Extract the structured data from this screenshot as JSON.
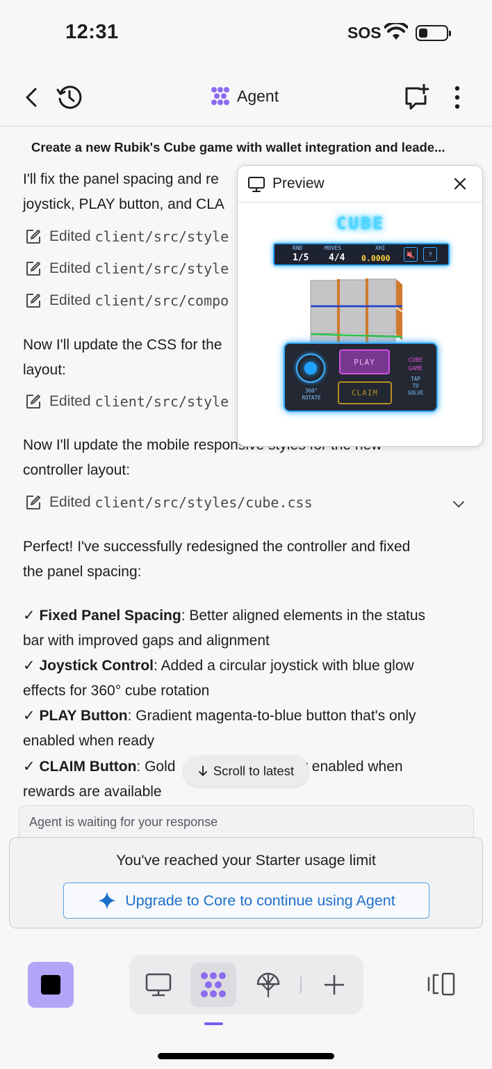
{
  "status_bar": {
    "time": "12:31",
    "sos": "SOS"
  },
  "header": {
    "title": "Agent",
    "icons": [
      "back-icon",
      "history-icon",
      "agent-logo-icon",
      "new-chat-icon",
      "more-icon"
    ]
  },
  "topic": "Create a new Rubik's Cube game with wallet integration and leade...",
  "messages": {
    "m1_line1": "I'll fix the panel spacing and re",
    "m1_line2": "joystick, PLAY button, and CLA",
    "edits1": [
      {
        "label": "Edited",
        "path": "client/src/style"
      },
      {
        "label": "Edited",
        "path": "client/src/style"
      },
      {
        "label": "Edited",
        "path": "client/src/compo"
      }
    ],
    "m2_line1": "Now I'll update the CSS for the",
    "m2_line2": "layout:",
    "edits2": [
      {
        "label": "Edited",
        "path": "client/src/style"
      }
    ],
    "m3_line1": "Now I'll update the mobile responsive styles for the new",
    "m3_line2": "controller layout:",
    "edits3": [
      {
        "label": "Edited",
        "path": "client/src/styles/cube.css"
      }
    ],
    "m4_line1": "Perfect! I've successfully redesigned the controller and fixed",
    "m4_line2": "the panel spacing:",
    "bullets": [
      {
        "check": "✓",
        "bold": "Fixed Panel Spacing",
        "l1": ": Better aligned elements in the status",
        "l2": "bar with improved gaps and alignment"
      },
      {
        "check": "✓",
        "bold": "Joystick Control",
        "l1": ": Added a circular joystick with blue glow",
        "l2": "effects for 360° cube rotation"
      },
      {
        "check": "✓",
        "bold": "PLAY Button",
        "l1": ": Gradient magenta-to-blue button that's only",
        "l2": "enabled when ready"
      },
      {
        "check": "✓",
        "bold": "CLAIM Button",
        "l1": ": Gold",
        "l1b": "y enabled when",
        "l2": "rewards are available"
      }
    ]
  },
  "scroll_pill": {
    "label": "Scroll to latest"
  },
  "preview": {
    "title": "Preview",
    "game": {
      "title": "CUBE",
      "hud": {
        "rnd_label": "RND",
        "moves_label": "MOVES",
        "xhi_label": "XHI",
        "rnd_value": "1/5",
        "moves_value": "4/4",
        "xhi_value": "0.0000",
        "help": "?"
      },
      "play": "PLAY",
      "claim": "CLAIM",
      "rotate_l1": "360°",
      "rotate_l2": "ROTATE",
      "side_l1": "CUBE",
      "side_l2": "GAME",
      "tap_l1": "TAP",
      "tap_l2": "TO",
      "tap_l3": "SOLVE"
    }
  },
  "composer": {
    "placeholder": "Agent is waiting for your response"
  },
  "usage": {
    "text": "You've reached your Starter usage limit",
    "upgrade": "Upgrade to Core to continue using Agent"
  },
  "toolbar": {
    "items": [
      "preview-icon",
      "agent-icon",
      "deploy-icon",
      "add-icon"
    ],
    "active": "agent-icon"
  },
  "colors": {
    "accent": "#7c5cf0",
    "stop": "#b3a4f8",
    "link": "#1e6fc9",
    "cube_glow": "#4fd6ff"
  }
}
